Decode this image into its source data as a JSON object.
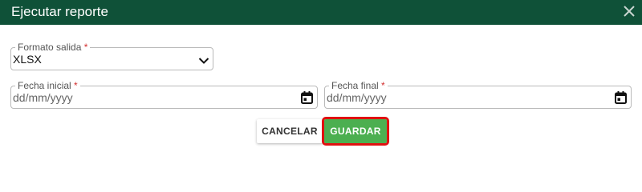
{
  "dialog": {
    "title": "Ejecutar reporte"
  },
  "form": {
    "format": {
      "label": "Formato salida",
      "required_mark": "*",
      "value": "XLSX"
    },
    "start_date": {
      "label": "Fecha inicial",
      "required_mark": "*",
      "placeholder": "dd/mm/yyyy"
    },
    "end_date": {
      "label": "Fecha final",
      "required_mark": "*",
      "placeholder": "dd/mm/yyyy"
    }
  },
  "actions": {
    "cancel_label": "CANCELAR",
    "save_label": "GUARDAR"
  },
  "colors": {
    "header_bg": "#0f5138",
    "save_bg": "#4caf50",
    "highlight": "#e01010",
    "required": "#d32f2f"
  },
  "icons": [
    "close-icon",
    "chevron-down-icon",
    "calendar-icon"
  ]
}
